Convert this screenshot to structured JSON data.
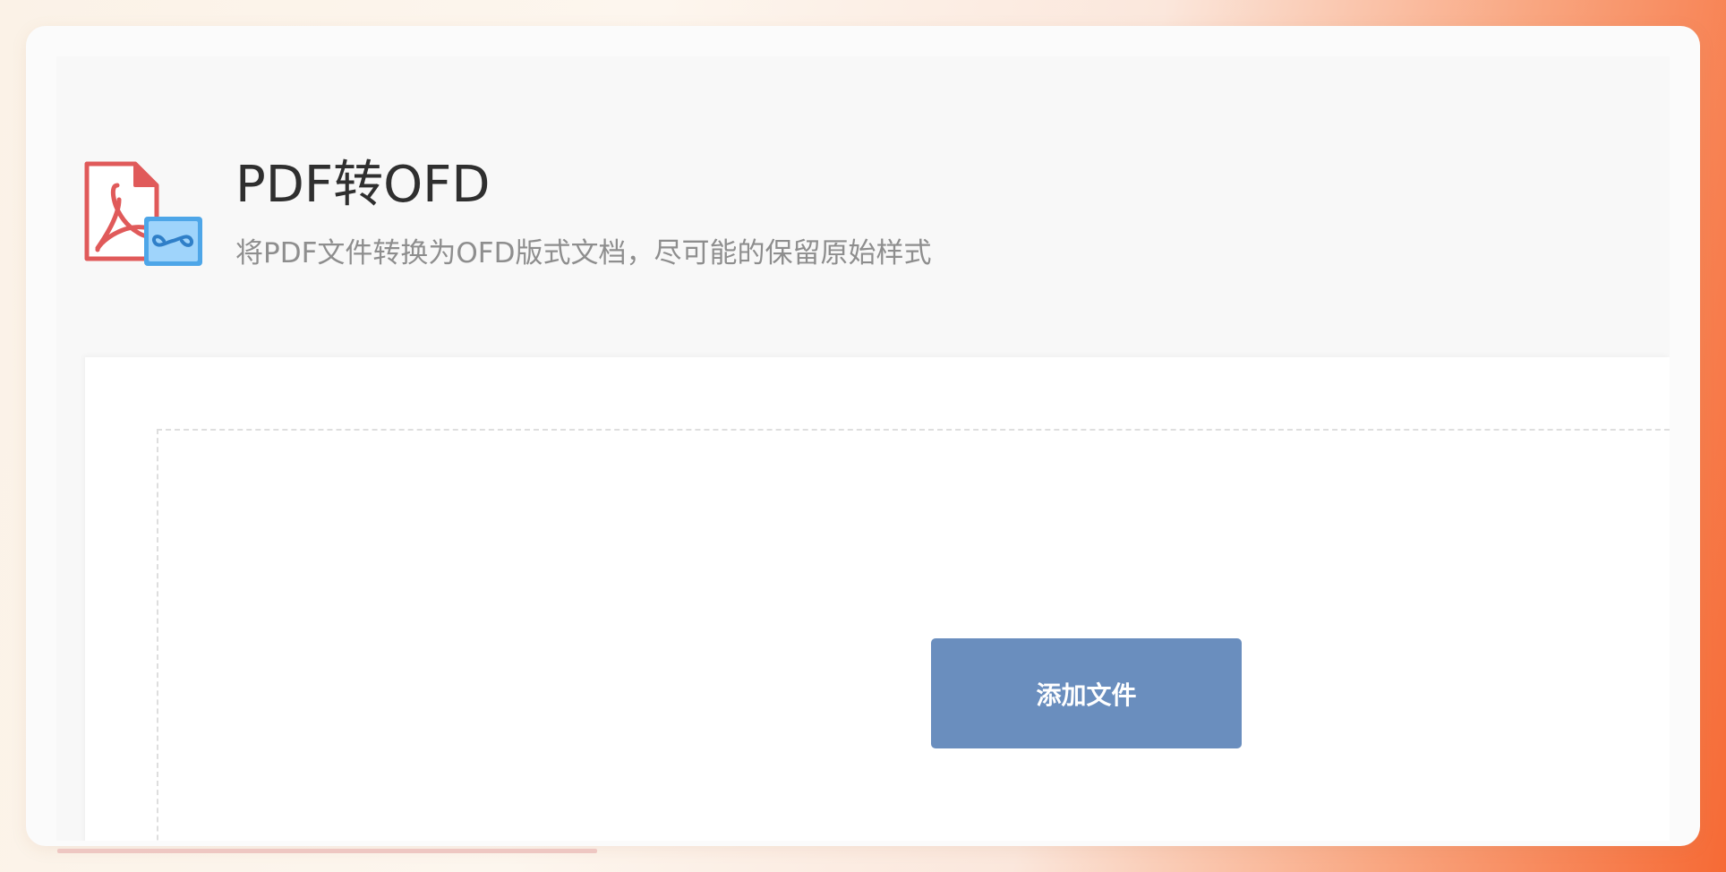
{
  "app": {
    "title": "PDF转OFD",
    "subtitle": "将PDF文件转换为OFD版式文档，尽可能的保留原始样式",
    "icon": "pdf-to-ofd-icon"
  },
  "upload": {
    "add_button_label": "添加文件"
  },
  "colors": {
    "button": "#6a8ebe",
    "pdf_icon": "#e05a5a",
    "ofd_icon": "#4ea6e8"
  }
}
